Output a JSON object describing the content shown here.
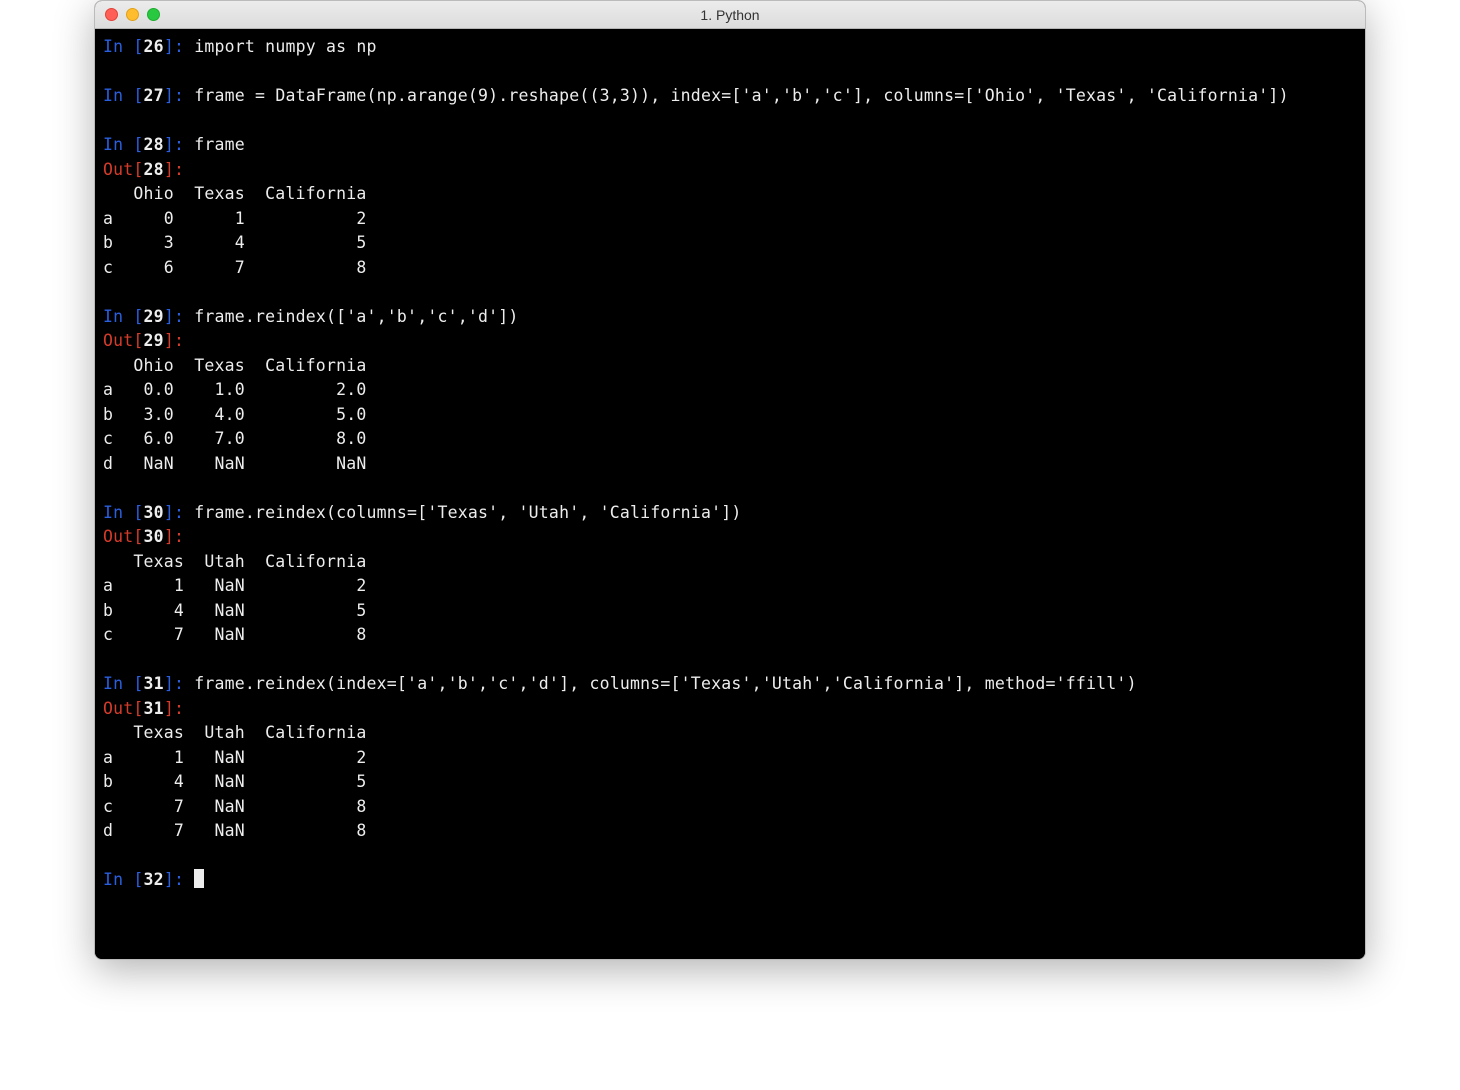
{
  "window": {
    "title": "1. Python"
  },
  "cells": [
    {
      "n": "26",
      "in": "import numpy as np",
      "out": null
    },
    {
      "n": "27",
      "in": "frame = DataFrame(np.arange(9).reshape((3,3)), index=['a','b','c'], columns=['Ohio', 'Texas', 'California'])",
      "out": null
    },
    {
      "n": "28",
      "in": "frame",
      "out": "   Ohio  Texas  California\na     0      1           2\nb     3      4           5\nc     6      7           8"
    },
    {
      "n": "29",
      "in": "frame.reindex(['a','b','c','d'])",
      "out": "   Ohio  Texas  California\na   0.0    1.0         2.0\nb   3.0    4.0         5.0\nc   6.0    7.0         8.0\nd   NaN    NaN         NaN"
    },
    {
      "n": "30",
      "in": "frame.reindex(columns=['Texas', 'Utah', 'California'])",
      "out": "   Texas  Utah  California\na      1   NaN           2\nb      4   NaN           5\nc      7   NaN           8"
    },
    {
      "n": "31",
      "in": "frame.reindex(index=['a','b','c','d'], columns=['Texas','Utah','California'], method='ffill')",
      "out": "   Texas  Utah  California\na      1   NaN           2\nb      4   NaN           5\nc      7   NaN           8\nd      7   NaN           8"
    }
  ],
  "next_prompt_n": "32"
}
